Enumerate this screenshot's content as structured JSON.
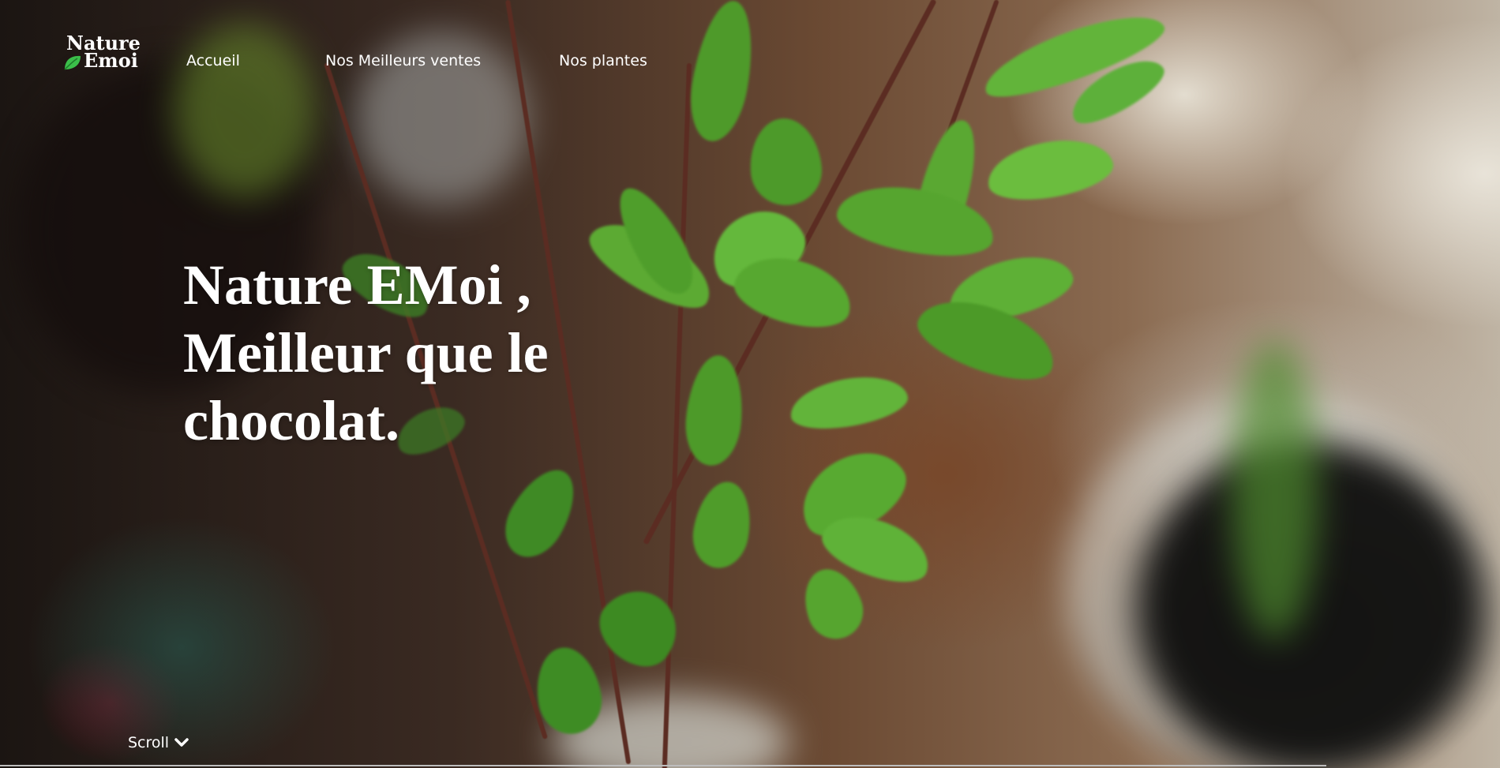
{
  "brand": {
    "line1": "Nature",
    "line2": "Emoi",
    "logo_icon": "leaf-icon",
    "accent_color": "#3bbf4a"
  },
  "nav": {
    "items": [
      {
        "label": "Accueil"
      },
      {
        "label": "Nos Meilleurs ventes"
      },
      {
        "label": "Nos plantes"
      }
    ]
  },
  "hero": {
    "headline": "Nature EMoi , Meilleur que le chocolat.",
    "background_image": "blurred green plant branches in a vase"
  },
  "scroll": {
    "label": "Scroll",
    "icon": "chevron-down-icon"
  }
}
